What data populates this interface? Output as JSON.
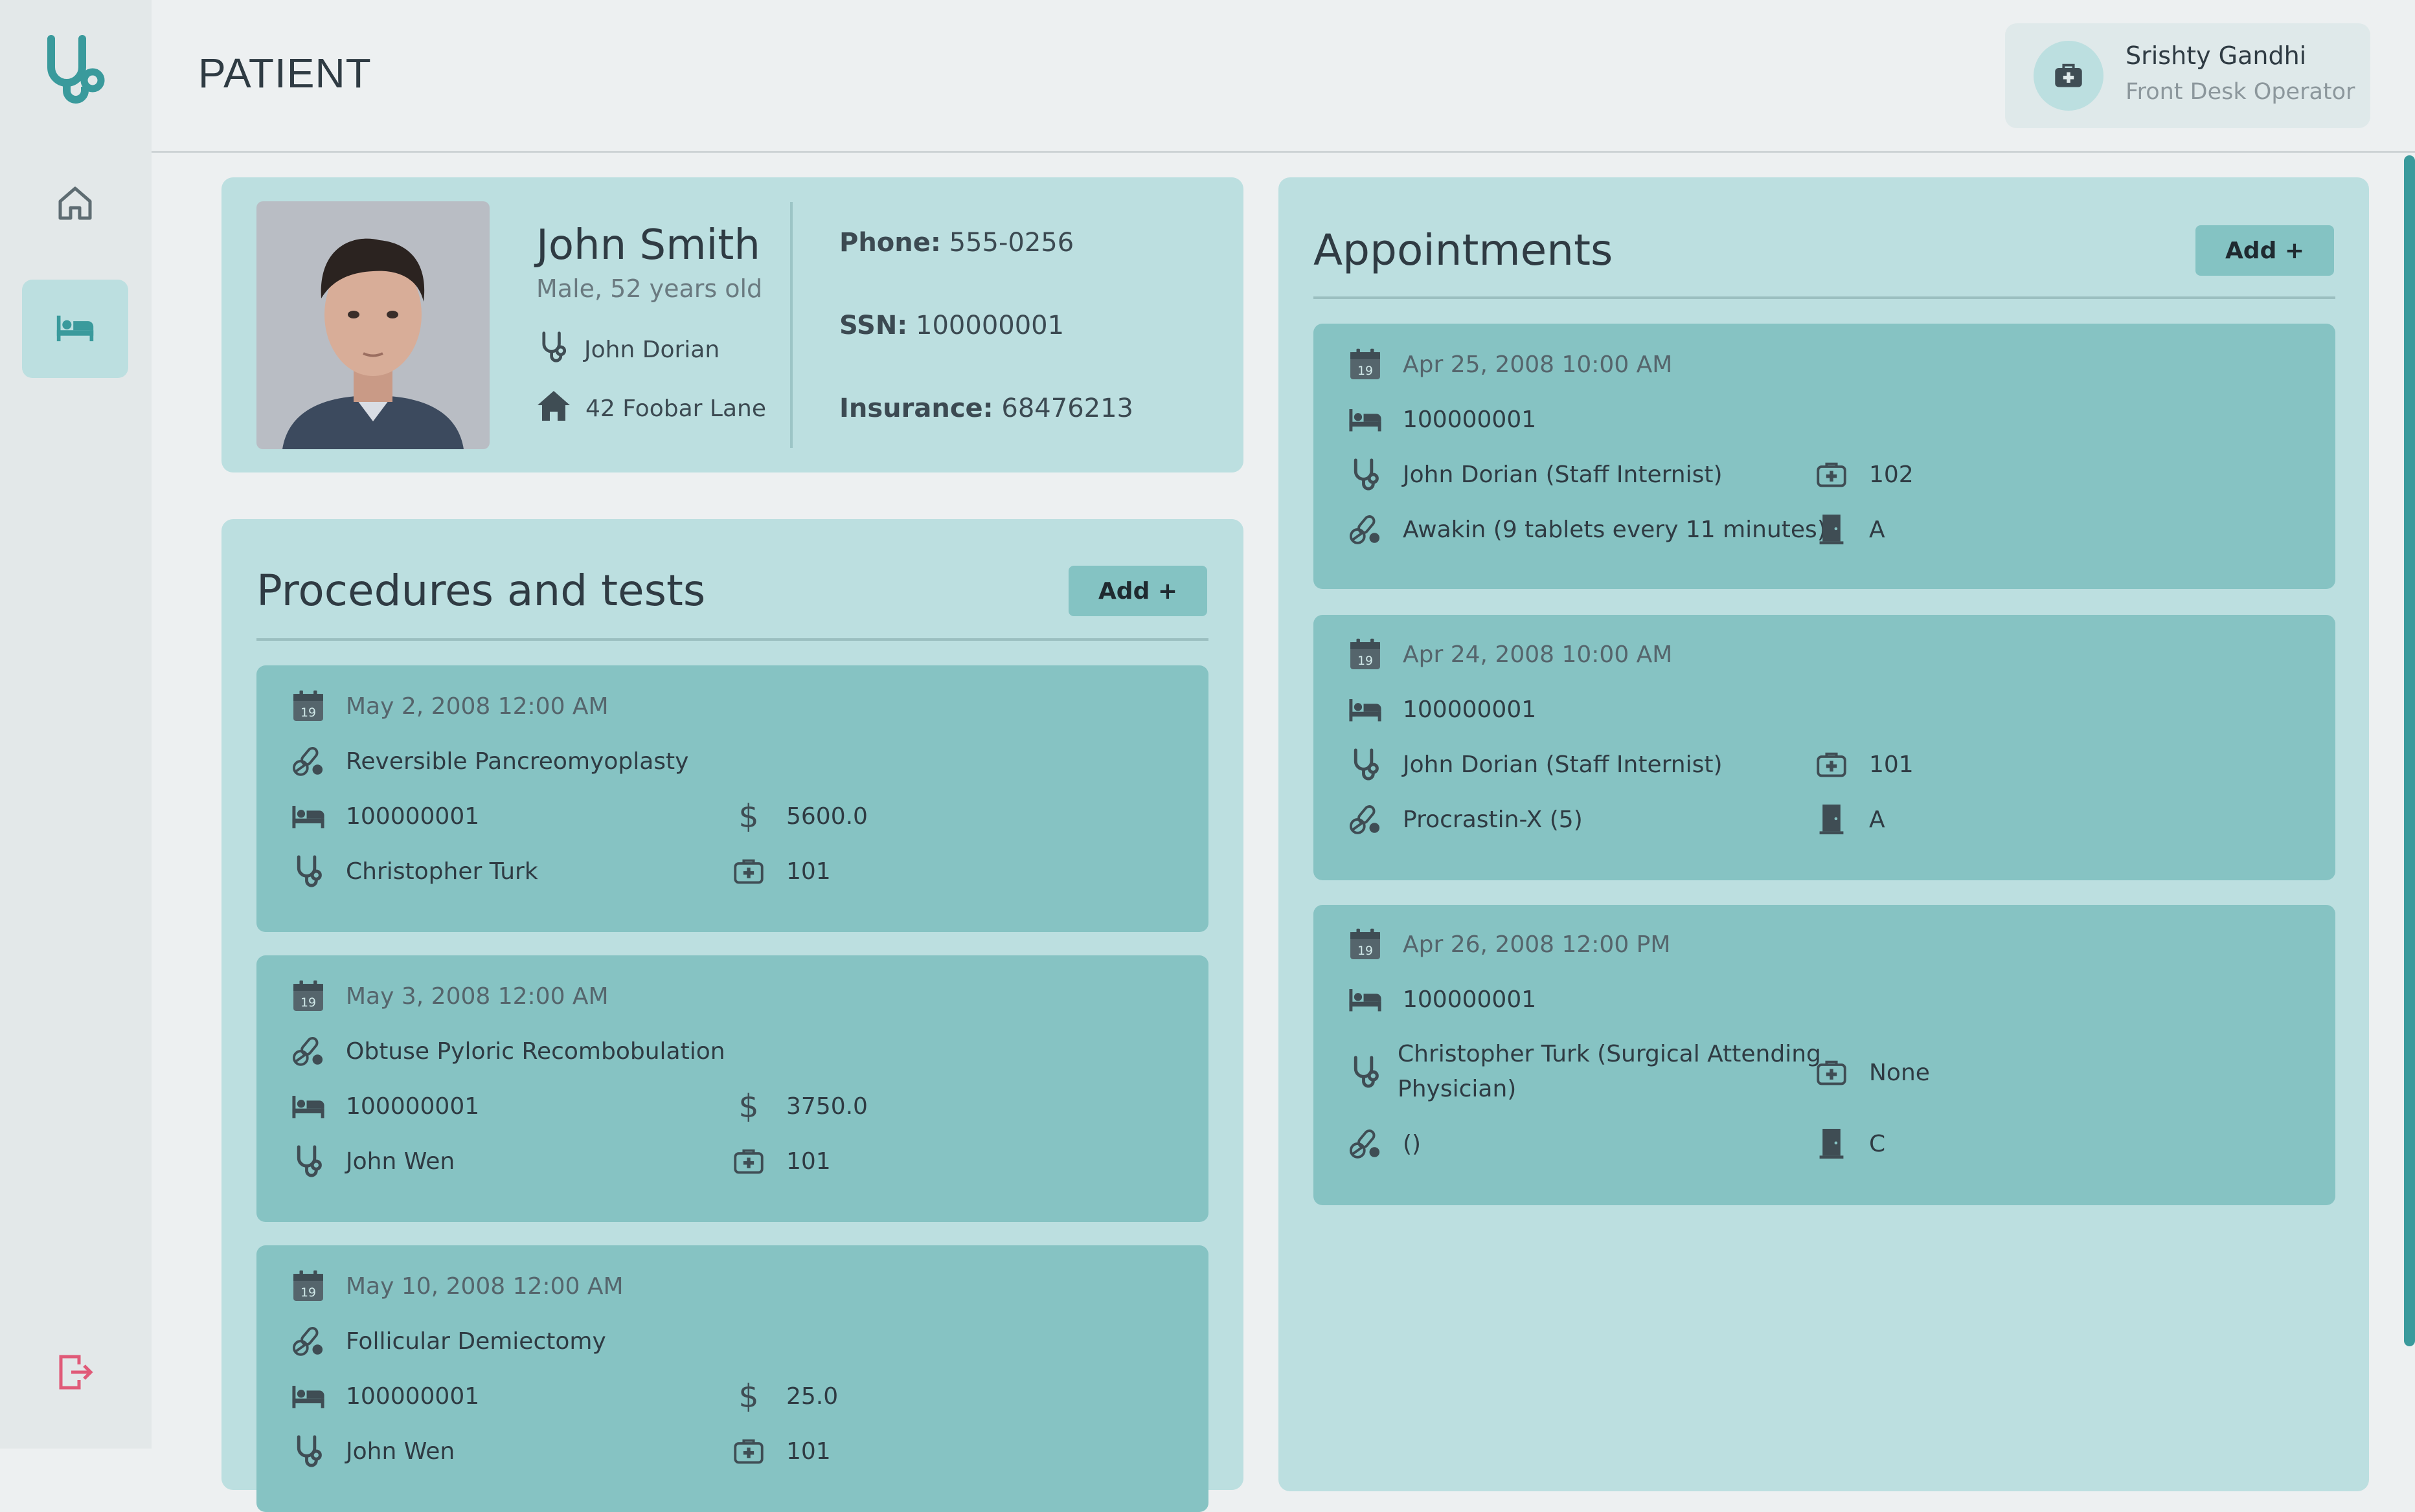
{
  "app": {
    "page_title": "PATIENT"
  },
  "user": {
    "name": "Srishty Gandhi",
    "role": "Front Desk Operator"
  },
  "patient": {
    "name": "John Smith",
    "sub": "Male, 52 years old",
    "physician": "John Dorian",
    "address": "42 Foobar Lane",
    "phone_label": "Phone:",
    "phone": "555-0256",
    "ssn_label": "SSN:",
    "ssn": "100000001",
    "insurance_label": "Insurance:",
    "insurance": "68476213"
  },
  "procedures": {
    "title": "Procedures and tests",
    "add_label": "Add +",
    "items": [
      {
        "date": "May 2, 2008 12:00 AM",
        "name": "Reversible Pancreomyoplasty",
        "patient": "100000001",
        "cost": "5600.0",
        "physician": "Christopher Turk",
        "room": "101"
      },
      {
        "date": "May 3, 2008 12:00 AM",
        "name": "Obtuse Pyloric Recombobulation",
        "patient": "100000001",
        "cost": "3750.0",
        "physician": "John Wen",
        "room": "101"
      },
      {
        "date": "May 10, 2008 12:00 AM",
        "name": "Follicular Demiectomy",
        "patient": "100000001",
        "cost": "25.0",
        "physician": "John Wen",
        "room": "101"
      }
    ]
  },
  "appointments": {
    "title": "Appointments",
    "add_label": "Add +",
    "items": [
      {
        "date": "Apr 25, 2008 10:00 AM",
        "patient": "100000001",
        "physician": "John Dorian (Staff Internist)",
        "room": "102",
        "medication": "Awakin (9 tablets every 11 minutes)",
        "block": "A"
      },
      {
        "date": "Apr 24, 2008 10:00 AM",
        "patient": "100000001",
        "physician": "John Dorian (Staff Internist)",
        "room": "101",
        "medication": "Procrastin-X (5)",
        "block": "A"
      },
      {
        "date": "Apr 26, 2008 12:00 PM",
        "patient": "100000001",
        "physician_line1": "Christopher Turk (Surgical Attending",
        "physician_line2": "Physician)",
        "room": "None",
        "medication": "()",
        "block": "C"
      }
    ]
  },
  "icons": {
    "logo": "stethoscope-icon",
    "home": "home-icon",
    "patients": "bed-icon",
    "logout": "logout-icon",
    "date": "calendar-icon",
    "procedure": "pills-icon",
    "patient": "bed-icon",
    "cost": "dollar-icon",
    "physician": "stethoscope-icon",
    "room": "medical-case-icon",
    "block": "door-icon",
    "address": "house-icon"
  },
  "colors": {
    "accent": "#3a9a9c",
    "panel": "#bcdfe0",
    "card": "#86c3c3",
    "logout": "#e05a78"
  }
}
